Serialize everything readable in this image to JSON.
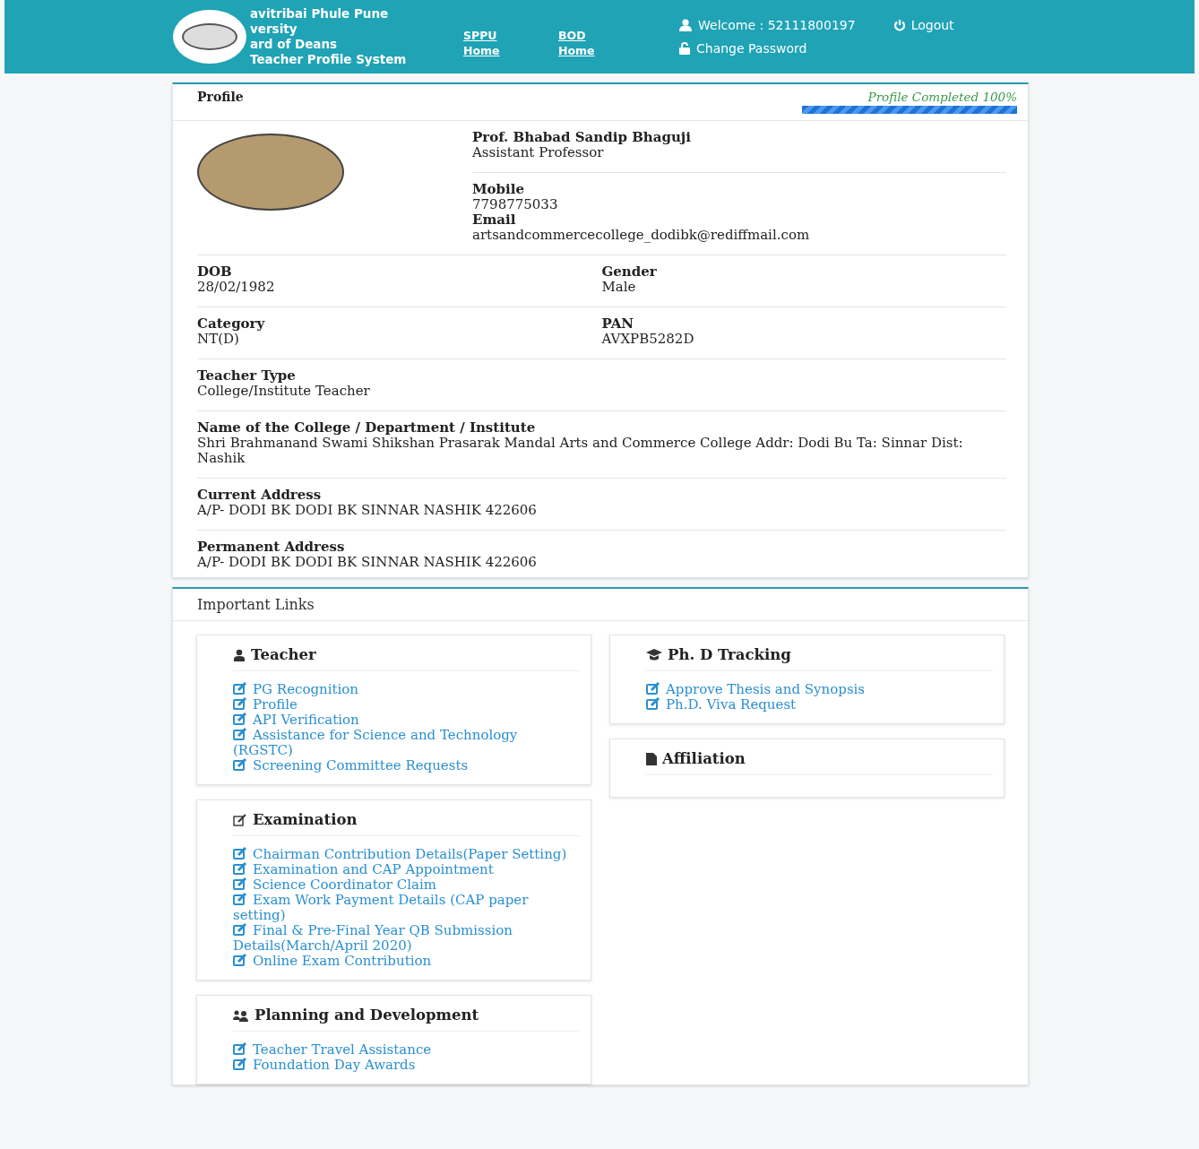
{
  "header": {
    "brand_lines": [
      "avitribai Phule Pune",
      "versity",
      "ard of Deans",
      "Teacher Profile System"
    ],
    "nav_links": [
      {
        "line1": "SPPU",
        "line2": "Home"
      },
      {
        "line1": "BOD",
        "line2": "Home"
      }
    ],
    "welcome": "Welcome : 52111800197",
    "change_password": "Change Password",
    "logout": "Logout"
  },
  "profile": {
    "title": "Profile",
    "completion": "Profile Completed 100%",
    "level": 1.0,
    "name": "Prof. Bhabad Sandip Bhaguji",
    "designation": "Assistant Professor",
    "contact": [
      {
        "label": "Mobile",
        "value": "7798775033"
      },
      {
        "label": "Email",
        "value": "artsandcommercecollege_dodibk@rediffmail.com"
      }
    ],
    "rows": [
      [
        {
          "label": "DOB",
          "value": "28/02/1982"
        },
        {
          "label": "Gender",
          "value": "Male"
        }
      ],
      [
        {
          "label": "Category",
          "value": "NT(D)"
        },
        {
          "label": "PAN",
          "value": "AVXPB5282D"
        }
      ],
      [
        {
          "label": "Teacher Type",
          "value": "College/Institute Teacher"
        }
      ],
      [
        {
          "label": "Name of the College / Department / Institute",
          "value": "Shri Brahmanand Swami Shikshan Prasarak Mandal Arts and Commerce College Addr: Dodi Bu Ta: Sinnar Dist: Nashik"
        }
      ],
      [
        {
          "label": "Current Address",
          "value": "A/P- DODI BK DODI BK SINNAR NASHIK 422606"
        }
      ],
      [
        {
          "label": "Permanent Address",
          "value": "A/P- DODI BK DODI BK SINNAR NASHIK 422606"
        }
      ]
    ]
  },
  "important_links": {
    "title": "Important Links",
    "columns": [
      [
        {
          "title": "Teacher",
          "kind": "teacher",
          "links": [
            "PG Recognition",
            "Profile",
            "API Verification",
            "Assistance for Science and Technology (RGSTC)",
            "Screening Committee Requests"
          ]
        },
        {
          "title": "Examination",
          "kind": "edit",
          "links": [
            "Chairman Contribution Details(Paper Setting)",
            "Examination and CAP Appointment",
            "Science Coordinator Claim",
            "Exam Work Payment Details (CAP paper setting)",
            "Final & Pre-Final Year QB Submission Details(March/April 2020)",
            "Online Exam Contribution"
          ]
        },
        {
          "title": "Planning and Development",
          "kind": "group",
          "links": [
            "Teacher Travel Assistance",
            "Foundation Day Awards"
          ]
        }
      ],
      [
        {
          "title": "Ph. D Tracking",
          "kind": "cap",
          "links": [
            "Approve Thesis and Synopsis",
            "Ph.D. Viva Request"
          ]
        },
        {
          "title": "Affiliation",
          "kind": "file"
        }
      ]
    ]
  }
}
